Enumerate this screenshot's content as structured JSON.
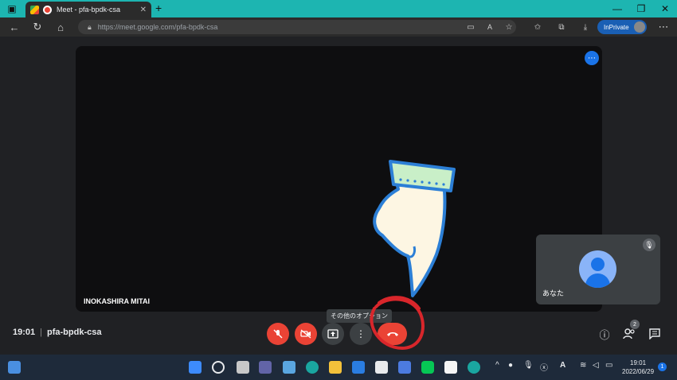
{
  "browser": {
    "tab_title": "Meet - pfa-bpdk-csa",
    "url_host": "https://meet.google.com",
    "url_path": "/pfa-bpdk-csa",
    "inprivate_label": "InPrivate"
  },
  "meet": {
    "participant_name": "INOKASHIRA MITAI",
    "self_label": "あなた",
    "time": "19:01",
    "meeting_code": "pfa-bpdk-csa",
    "tooltip": "その他のオプション",
    "people_count": "2"
  },
  "taskbar": {
    "time": "19:01",
    "date": "2022/06/29",
    "notifications": "1"
  },
  "colors": {
    "accent": "#1a73e8",
    "danger": "#ea4335",
    "annotation_ring": "#d8262b",
    "hand_fill": "#fdf6e3",
    "hand_cuff": "#c9efc8",
    "hand_outline": "#2c7fd6"
  }
}
